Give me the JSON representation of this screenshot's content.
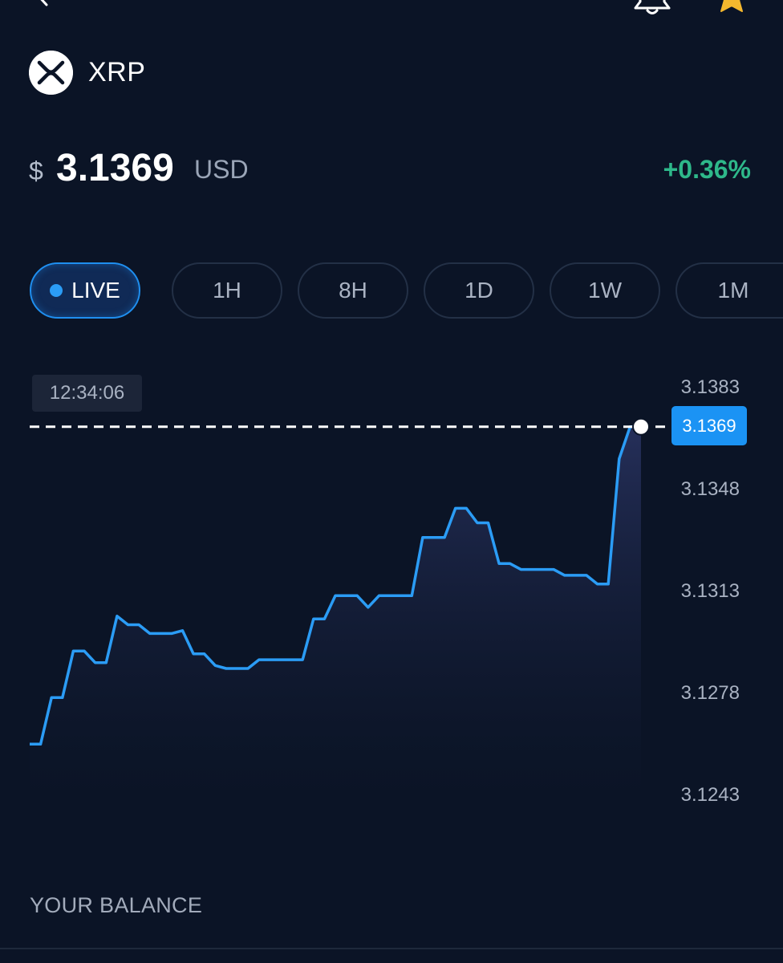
{
  "header": {
    "coin_name": "XRP"
  },
  "price": {
    "currency_symbol": "$",
    "value": "3.1369",
    "currency_code": "USD",
    "change": "+0.36%",
    "change_color": "#2eb88a"
  },
  "tabs": [
    {
      "label": "LIVE",
      "active": true
    },
    {
      "label": "1H",
      "active": false
    },
    {
      "label": "8H",
      "active": false
    },
    {
      "label": "1D",
      "active": false
    },
    {
      "label": "1W",
      "active": false
    },
    {
      "label": "1M",
      "active": false
    }
  ],
  "chart_data": {
    "type": "line",
    "hover_time": "12:34:06",
    "current_value_label": "3.1369",
    "y_ticks": [
      "3.1383",
      "3.1348",
      "3.1313",
      "3.1278",
      "3.1243"
    ],
    "ylim": [
      3.1243,
      3.1383
    ],
    "current": 3.1369,
    "line_color": "#2b9cf5",
    "series": [
      {
        "values": [
          3.126,
          3.126,
          3.1276,
          3.1276,
          3.1292,
          3.1292,
          3.1288,
          3.1288,
          3.1304,
          3.1301,
          3.1301,
          3.1298,
          3.1298,
          3.1298,
          3.1299,
          3.1291,
          3.1291,
          3.1287,
          3.1286,
          3.1286,
          3.1286,
          3.1289,
          3.1289,
          3.1289,
          3.1289,
          3.1289,
          3.1303,
          3.1303,
          3.1311,
          3.1311,
          3.1311,
          3.1307,
          3.1311,
          3.1311,
          3.1311,
          3.1311,
          3.1331,
          3.1331,
          3.1331,
          3.1341,
          3.1341,
          3.1336,
          3.1336,
          3.1322,
          3.1322,
          3.132,
          3.132,
          3.132,
          3.132,
          3.1318,
          3.1318,
          3.1318,
          3.1315,
          3.1315,
          3.1358,
          3.1369,
          3.1369
        ]
      }
    ]
  },
  "balance": {
    "label": "YOUR BALANCE"
  }
}
